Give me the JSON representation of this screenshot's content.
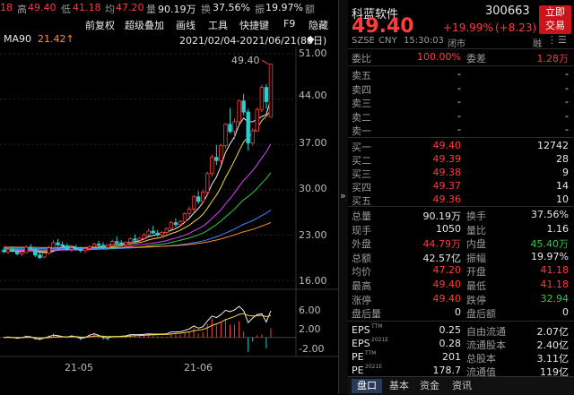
{
  "info_bar": {
    "prefix_value": "18",
    "high_label": "高",
    "high_value": "49.40",
    "low_label": "低",
    "low_value": "41.18",
    "avg_label": "均",
    "avg_value": "47.20",
    "volume_label": "量",
    "volume_value": "90.19万",
    "turnover_label": "换",
    "turnover_value": "37.56%",
    "amplitude_label": "振",
    "amplitude_value": "19.97%",
    "amount_label": "额"
  },
  "toolbar": {
    "items": [
      "前复权",
      "超级叠加",
      "画线",
      "工具",
      "快捷键",
      "F9",
      "隐藏"
    ]
  },
  "ma_row": {
    "ma_label": "MA90",
    "ma_value": "21.42↑",
    "date_range": "2021/02/04-2021/06/21(88日)"
  },
  "price_chart": {
    "y_ticks": [
      "51.00",
      "44.00",
      "37.00",
      "30.00",
      "23.00",
      "16.00"
    ],
    "y_range": [
      16,
      51
    ],
    "max_marker": "49.40",
    "candles": [
      [
        20.6,
        20.9,
        20.2,
        20.5
      ],
      [
        20.4,
        21.0,
        20.1,
        20.8
      ],
      [
        20.7,
        21.2,
        20.3,
        20.5
      ],
      [
        20.5,
        20.8,
        19.9,
        20.1
      ],
      [
        20.1,
        20.6,
        19.8,
        20.4
      ],
      [
        20.3,
        21.4,
        20.2,
        21.1
      ],
      [
        21.0,
        21.6,
        20.7,
        20.9
      ],
      [
        20.8,
        21.0,
        19.6,
        19.9
      ],
      [
        19.9,
        20.3,
        19.3,
        19.5
      ],
      [
        19.6,
        20.4,
        19.4,
        20.2
      ],
      [
        20.2,
        21.3,
        20.0,
        21.0
      ],
      [
        21.1,
        22.2,
        20.9,
        21.8
      ],
      [
        21.8,
        22.4,
        21.2,
        21.5
      ],
      [
        21.5,
        22.0,
        20.9,
        21.3
      ],
      [
        21.3,
        21.7,
        20.6,
        20.8
      ],
      [
        20.8,
        21.3,
        20.4,
        21.0
      ],
      [
        21.0,
        21.5,
        20.6,
        20.8
      ],
      [
        20.8,
        21.2,
        20.3,
        20.6
      ],
      [
        20.6,
        21.0,
        20.2,
        20.9
      ],
      [
        20.9,
        21.4,
        20.6,
        21.2
      ],
      [
        21.2,
        21.8,
        21.0,
        21.6
      ],
      [
        21.6,
        22.1,
        21.2,
        21.4
      ],
      [
        21.4,
        21.9,
        20.9,
        21.1
      ],
      [
        21.1,
        21.6,
        20.8,
        21.5
      ],
      [
        21.5,
        22.3,
        21.3,
        22.0
      ],
      [
        22.0,
        22.8,
        21.6,
        21.8
      ],
      [
        21.8,
        22.2,
        21.3,
        21.5
      ],
      [
        21.5,
        22.0,
        21.2,
        21.9
      ],
      [
        21.9,
        22.6,
        21.7,
        22.4
      ],
      [
        22.4,
        23.1,
        22.0,
        22.2
      ],
      [
        22.2,
        22.7,
        21.9,
        22.5
      ],
      [
        22.5,
        23.3,
        22.3,
        23.0
      ],
      [
        23.0,
        24.0,
        22.8,
        23.6
      ],
      [
        23.6,
        24.4,
        23.2,
        23.3
      ],
      [
        23.3,
        23.8,
        22.7,
        23.0
      ],
      [
        23.0,
        23.6,
        22.6,
        23.4
      ],
      [
        23.4,
        24.2,
        23.1,
        24.0
      ],
      [
        24.0,
        25.2,
        23.8,
        24.9
      ],
      [
        24.9,
        25.6,
        24.2,
        24.6
      ],
      [
        24.6,
        25.3,
        24.3,
        25.1
      ],
      [
        25.1,
        26.5,
        25.0,
        26.3
      ],
      [
        26.3,
        27.4,
        25.8,
        27.0
      ],
      [
        27.0,
        29.2,
        26.6,
        28.9
      ],
      [
        28.9,
        29.8,
        27.8,
        28.2
      ],
      [
        28.2,
        30.0,
        28.0,
        29.6
      ],
      [
        29.6,
        32.8,
        29.2,
        32.5
      ],
      [
        32.5,
        35.4,
        32.1,
        35.0
      ],
      [
        35.0,
        36.9,
        33.8,
        34.5
      ],
      [
        34.5,
        37.1,
        34.0,
        36.8
      ],
      [
        36.8,
        40.3,
        36.4,
        40.1
      ],
      [
        40.1,
        42.6,
        38.7,
        39.0
      ],
      [
        39.0,
        41.0,
        37.8,
        40.5
      ],
      [
        40.5,
        43.9,
        40.2,
        43.7
      ],
      [
        43.7,
        44.8,
        41.5,
        42.0
      ],
      [
        42.0,
        42.5,
        36.0,
        37.2
      ],
      [
        37.2,
        39.5,
        36.8,
        39.1
      ],
      [
        39.1,
        42.7,
        38.9,
        42.4
      ],
      [
        42.4,
        46.2,
        42.0,
        45.8
      ],
      [
        45.8,
        46.3,
        42.5,
        43.6
      ],
      [
        41.2,
        49.4,
        41.18,
        49.4
      ]
    ],
    "ma_colors": [
      "#f0f0f0",
      "#f5d442",
      "#e040fb",
      "#2ecc40",
      "#3b8bff",
      "#ff8c2a"
    ]
  },
  "x_axis": {
    "labels": [
      "21-05",
      "21-06"
    ]
  },
  "macd_chart": {
    "y_ticks": [
      "6.00",
      "2.00",
      "-2.00"
    ],
    "y_range": [
      -3,
      7
    ]
  },
  "quote": {
    "name": "科蓝软件",
    "code": "300663",
    "price": "49.40",
    "change_pct": "+19.99%",
    "change_amt": "(+8.23)",
    "market": "SZSE",
    "currency": "CNY",
    "time": "15:30:03",
    "status": "闭市",
    "badge_rong": "融",
    "trade_button": [
      "立即",
      "交易"
    ]
  },
  "order_book": {
    "ratio_label": "委比",
    "ratio_value": "100.00%",
    "diff_label": "委差",
    "diff_value": "1.28万",
    "asks": [
      {
        "label": "卖五",
        "price": "-",
        "vol": "-"
      },
      {
        "label": "卖四",
        "price": "-",
        "vol": "-"
      },
      {
        "label": "卖三",
        "price": "-",
        "vol": "-"
      },
      {
        "label": "卖二",
        "price": "-",
        "vol": "-"
      },
      {
        "label": "卖一",
        "price": "-",
        "vol": "-"
      }
    ],
    "bids": [
      {
        "label": "买一",
        "price": "49.40",
        "vol": "12742"
      },
      {
        "label": "买二",
        "price": "49.39",
        "vol": "28"
      },
      {
        "label": "买三",
        "price": "49.38",
        "vol": "9"
      },
      {
        "label": "买四",
        "price": "49.37",
        "vol": "14"
      },
      {
        "label": "买五",
        "price": "49.36",
        "vol": "10"
      }
    ]
  },
  "stats": [
    {
      "l1": "总量",
      "v1": "90.19万",
      "c1": "white",
      "l2": "换手",
      "v2": "37.56%",
      "c2": "white"
    },
    {
      "l1": "现手",
      "v1": "1050",
      "c1": "white",
      "l2": "量比",
      "v2": "1.16",
      "c2": "white"
    },
    {
      "l1": "外盘",
      "v1": "44.79万",
      "c1": "red",
      "l2": "内盘",
      "v2": "45.40万",
      "c2": "green"
    },
    {
      "l1": "总额",
      "v1": "42.57亿",
      "c1": "white",
      "l2": "振幅",
      "v2": "19.97%",
      "c2": "white"
    },
    {
      "l1": "均价",
      "v1": "47.20",
      "c1": "red",
      "l2": "开盘",
      "v2": "41.18",
      "c2": "red"
    },
    {
      "l1": "最高",
      "v1": "49.40",
      "c1": "red",
      "l2": "最低",
      "v2": "41.18",
      "c2": "red"
    },
    {
      "l1": "涨停",
      "v1": "49.40",
      "c1": "red",
      "l2": "跌停",
      "v2": "32.94",
      "c2": "green"
    },
    {
      "l1": "盘后量",
      "v1": "0",
      "c1": "white",
      "l2": "盘后额",
      "v2": "0",
      "c2": "white"
    }
  ],
  "fundamentals": [
    {
      "l1": "EPS",
      "s1": "TTM",
      "v1": "0.25",
      "l2": "自由流通",
      "v2": "2.07亿"
    },
    {
      "l1": "EPS",
      "s1": "2021E",
      "v1": "0.28",
      "l2": "流通股本",
      "v2": "2.40亿"
    },
    {
      "l1": "PE",
      "s1": "TTM",
      "v1": "201",
      "l2": "总股本",
      "v2": "3.11亿"
    },
    {
      "l1": "PE",
      "s1": "2021E",
      "v1": "178.7",
      "l2": "流通值",
      "v2": "119亿"
    }
  ],
  "tabs": [
    "盘口",
    "基本",
    "资金",
    "资讯"
  ],
  "divider_label": "»"
}
